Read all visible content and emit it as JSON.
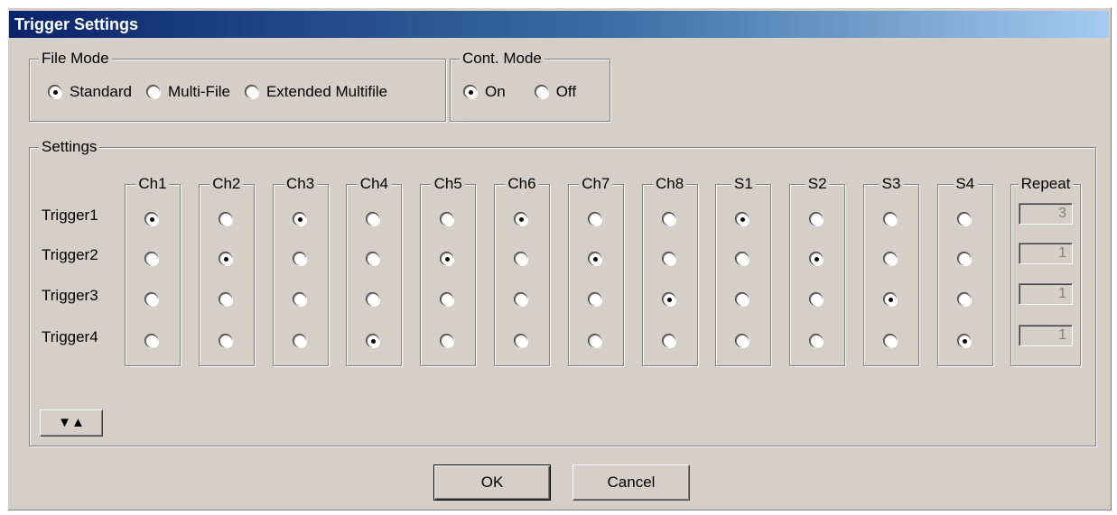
{
  "window": {
    "title": "Trigger Settings"
  },
  "file_mode": {
    "label": "File Mode",
    "options": [
      {
        "label": "Standard",
        "checked": true
      },
      {
        "label": "Multi-File",
        "checked": false
      },
      {
        "label": "Extended Multifile",
        "checked": false
      }
    ]
  },
  "cont_mode": {
    "label": "Cont. Mode",
    "options": [
      {
        "label": "On",
        "checked": true
      },
      {
        "label": "Off",
        "checked": false
      }
    ]
  },
  "settings": {
    "label": "Settings",
    "channels": [
      "Ch1",
      "Ch2",
      "Ch3",
      "Ch4",
      "Ch5",
      "Ch6",
      "Ch7",
      "Ch8",
      "S1",
      "S2",
      "S3",
      "S4"
    ],
    "repeat_label": "Repeat",
    "triggers": [
      {
        "label": "Trigger1",
        "selected": [
          1,
          0,
          1,
          0,
          0,
          1,
          0,
          0,
          1,
          0,
          0,
          0
        ],
        "repeat": "3"
      },
      {
        "label": "Trigger2",
        "selected": [
          0,
          1,
          0,
          0,
          1,
          0,
          1,
          0,
          0,
          1,
          0,
          0
        ],
        "repeat": "1"
      },
      {
        "label": "Trigger3",
        "selected": [
          0,
          0,
          0,
          0,
          0,
          0,
          0,
          1,
          0,
          0,
          1,
          0
        ],
        "repeat": "1"
      },
      {
        "label": "Trigger4",
        "selected": [
          0,
          0,
          0,
          1,
          0,
          0,
          0,
          0,
          0,
          0,
          0,
          1
        ],
        "repeat": "1"
      }
    ],
    "toggle_label": "▼▲"
  },
  "buttons": {
    "ok": "OK",
    "cancel": "Cancel"
  }
}
